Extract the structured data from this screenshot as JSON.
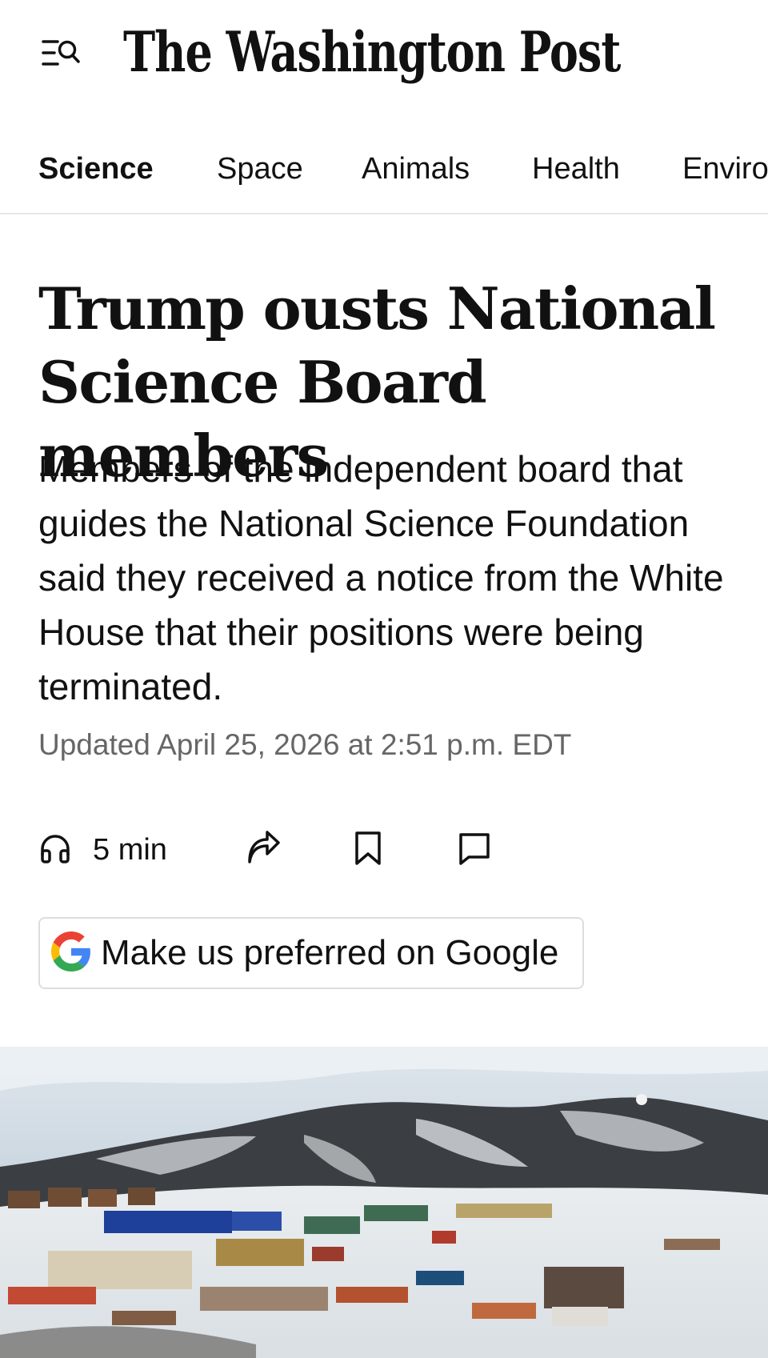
{
  "header": {
    "menu_icon": "menu-search-icon",
    "masthead": "The Washington Post"
  },
  "nav": {
    "items": [
      {
        "label": "Science",
        "active": true
      },
      {
        "label": "Space",
        "active": false
      },
      {
        "label": "Animals",
        "active": false
      },
      {
        "label": "Health",
        "active": false
      },
      {
        "label": "Enviro",
        "active": false
      }
    ]
  },
  "article": {
    "headline_line1": "Trump ousts National",
    "headline_line2": "Science Board members",
    "dek": "Members of the independent board that guides the National Science Foundation said they received a notice from the White House that their positions were being terminated.",
    "timestamp": "Updated April 25, 2026 at 2:51 p.m. EDT"
  },
  "actions": {
    "listen_label": "5 min",
    "listen_icon": "headphones-icon",
    "share_icon": "share-icon",
    "bookmark_icon": "bookmark-icon",
    "comment_icon": "comment-icon"
  },
  "google_button": {
    "label": "Make us preferred on Google",
    "icon": "google-logo-icon"
  },
  "photo": {
    "subject": "snow-covered research station at the foot of a dark volcanic hill"
  },
  "colors": {
    "text": "#111111",
    "muted": "#666666",
    "divider": "#e6e6e6",
    "google_blue": "#4285F4",
    "google_red": "#EA4335",
    "google_yellow": "#FBBC05",
    "google_green": "#34A853"
  }
}
